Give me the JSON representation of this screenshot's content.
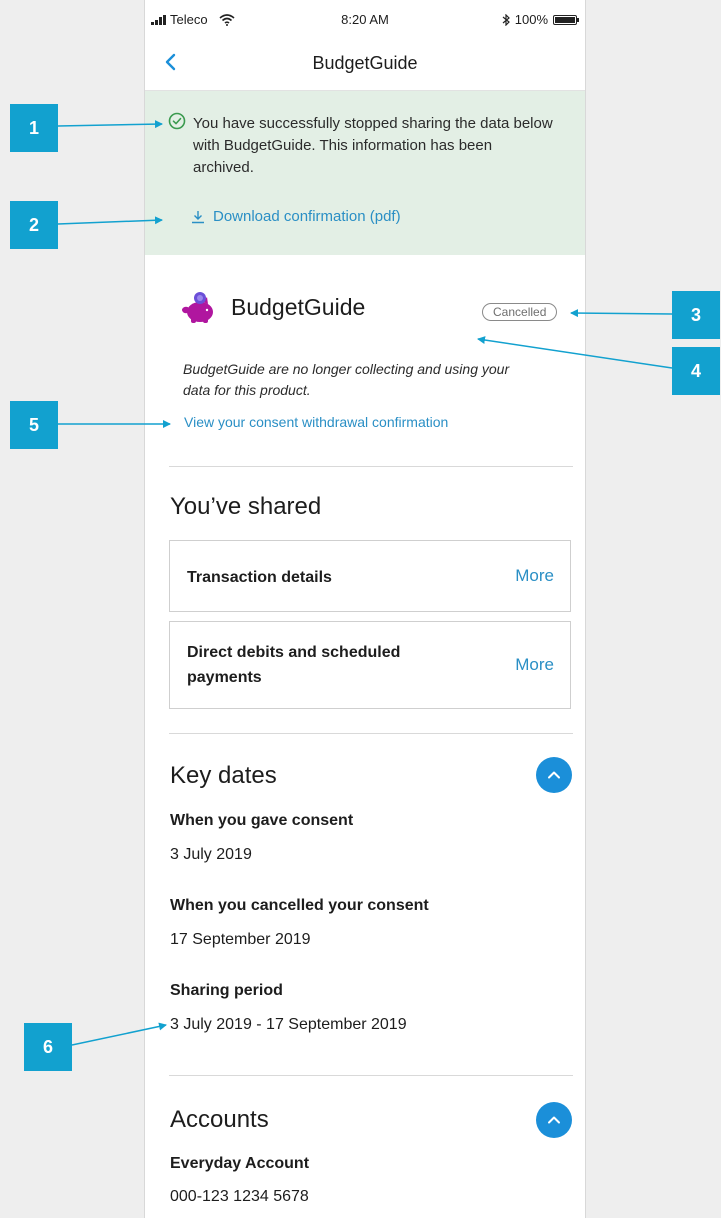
{
  "status_bar": {
    "carrier": "Teleco",
    "time": "8:20 AM",
    "battery": "100%"
  },
  "nav": {
    "title": "BudgetGuide",
    "back_icon": "chevron-left-icon"
  },
  "banner": {
    "message": "You have successfully stopped sharing the data below with BudgetGuide. This information has been archived.",
    "download_label": "Download confirmation (pdf)",
    "status_icon": "check-circle-icon"
  },
  "provider": {
    "name": "BudgetGuide",
    "logo_icon": "piggy-bank-icon",
    "status_badge": "Cancelled",
    "status_note": "BudgetGuide are no longer collecting and using your data for this product.",
    "withdrawal_link": "View your consent withdrawal confirmation"
  },
  "shared": {
    "heading": "You’ve shared",
    "items": [
      {
        "label": "Transaction details",
        "action": "More"
      },
      {
        "label": "Direct debits and scheduled payments",
        "action": "More"
      }
    ]
  },
  "key_dates": {
    "heading": "Key dates",
    "entries": [
      {
        "label": "When you gave consent",
        "value": "3 July 2019"
      },
      {
        "label": "When you cancelled your consent",
        "value": "17 September 2019"
      },
      {
        "label": "Sharing period",
        "value": "3 July 2019 - 17 September 2019"
      }
    ]
  },
  "accounts": {
    "heading": "Accounts",
    "items": [
      {
        "name": "Everyday Account",
        "number": "000-123 1234 5678"
      }
    ]
  },
  "annotations": [
    "1",
    "2",
    "3",
    "4",
    "5",
    "6"
  ],
  "colors": {
    "accent": "#2a8fc5",
    "banner_bg": "#e3efe5",
    "callout": "#12a1cf",
    "collapse_button": "#1b8fd9",
    "brand_logo": "#b0169f"
  }
}
